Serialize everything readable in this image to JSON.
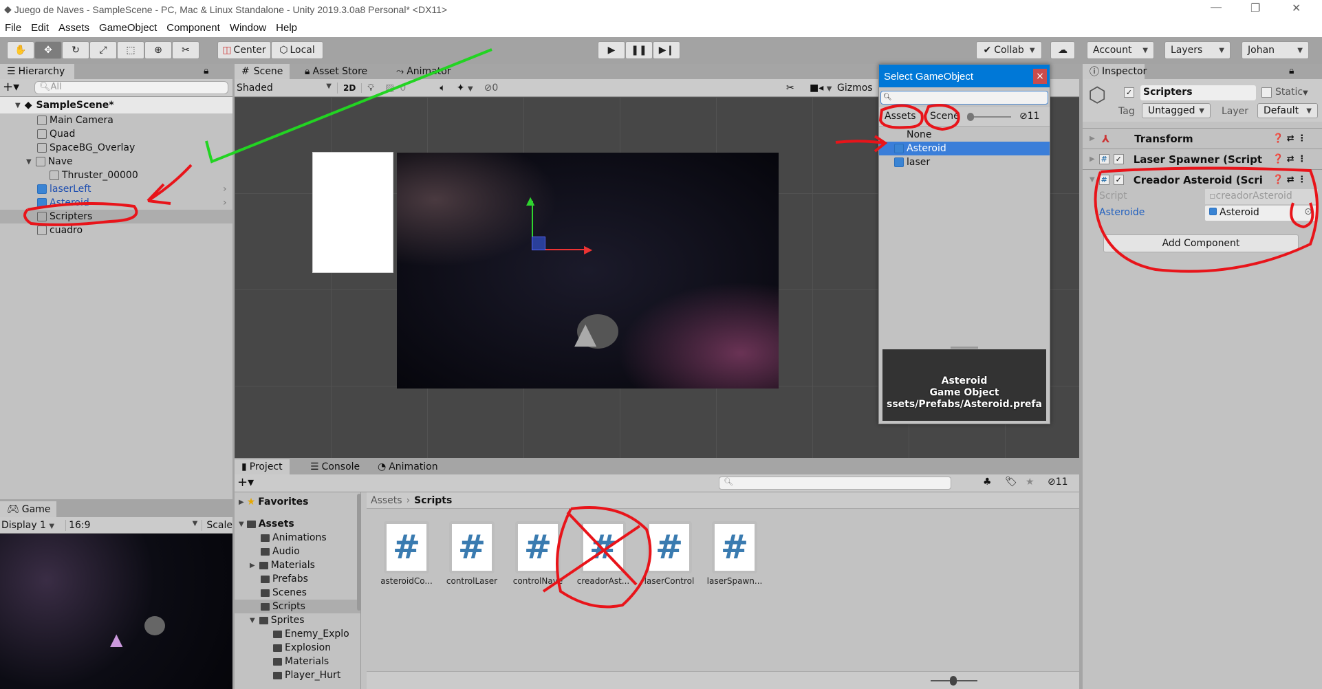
{
  "window": {
    "title": "Juego de Naves - SampleScene - PC, Mac & Linux Standalone - Unity 2019.3.0a8 Personal* <DX11>"
  },
  "menu": [
    "File",
    "Edit",
    "Assets",
    "GameObject",
    "Component",
    "Window",
    "Help"
  ],
  "toolbar": {
    "center": "Center",
    "local": "Local",
    "collab": "Collab",
    "account": "Account",
    "layers": "Layers",
    "user": "Johan"
  },
  "hierarchy": {
    "tab": "Hierarchy",
    "search_placeholder": "All",
    "scene": "SampleScene*",
    "items": [
      {
        "label": "Main Camera"
      },
      {
        "label": "Quad"
      },
      {
        "label": "SpaceBG_Overlay"
      },
      {
        "label": "Nave"
      },
      {
        "label": "Thruster_00000"
      },
      {
        "label": "laserLeft"
      },
      {
        "label": "Asteroid"
      },
      {
        "label": "Scripters"
      },
      {
        "label": "cuadro"
      }
    ]
  },
  "scene": {
    "tabs": [
      "Scene",
      "Asset Store",
      "Animator"
    ],
    "shading": "Shaded",
    "mode2d": "2D",
    "fx_value": "0",
    "hidden_count": "0",
    "gizmos": "Gizmos"
  },
  "game": {
    "tab": "Game",
    "display": "Display 1",
    "aspect": "16:9",
    "scale": "Scale"
  },
  "project": {
    "tabs": [
      "Project",
      "Console",
      "Animation"
    ],
    "hidden_count": "11",
    "favorites": "Favorites",
    "assets": "Assets",
    "tree": [
      "Animations",
      "Audio",
      "Materials",
      "Prefabs",
      "Scenes",
      "Scripts",
      "Sprites",
      "Enemy_Explo",
      "Explosion",
      "Materials",
      "Player_Hurt"
    ],
    "breadcrumb": [
      "Assets",
      "Scripts"
    ],
    "files": [
      "asteroidCo...",
      "controlLaser",
      "controlNave",
      "creadorAst...",
      "laserControl",
      "laserSpawn..."
    ]
  },
  "popup": {
    "title": "Select GameObject",
    "close": "×",
    "tabs": [
      "Assets",
      "Scene"
    ],
    "hidden_count": "11",
    "items": [
      "None",
      "Asteroid",
      "laser"
    ],
    "preview": {
      "name": "Asteroid",
      "type": "Game Object",
      "path": "ssets/Prefabs/Asteroid.prefa"
    }
  },
  "inspector": {
    "tab": "Inspector",
    "object_name": "Scripters",
    "static": "Static",
    "tag_label": "Tag",
    "tag": "Untagged",
    "layer_label": "Layer",
    "layer": "Default",
    "components": [
      "Transform",
      "Laser Spawner (Script",
      "Creador Asteroid (Scri"
    ],
    "script_label": "Script",
    "script_value": "creadorAsteroid",
    "field_label": "Asteroide",
    "field_value": "Asteroid",
    "add_component": "Add Component"
  },
  "colors": {
    "selection": "#3a7ed9",
    "popup_header": "#0078d7",
    "annotation_red": "#e8141a",
    "annotation_green": "#22d422"
  }
}
